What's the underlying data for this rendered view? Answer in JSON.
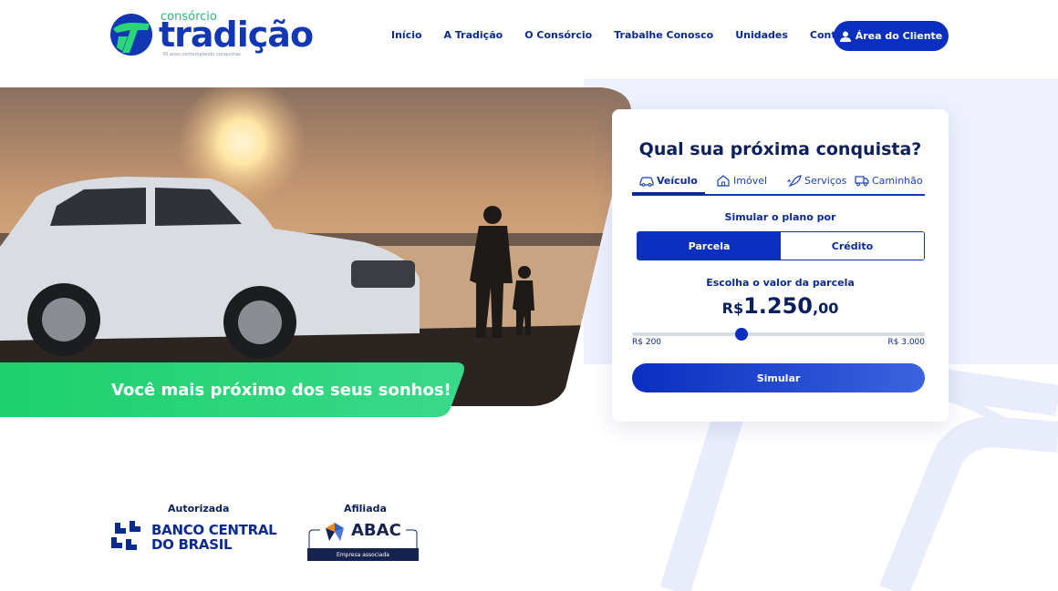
{
  "logo": {
    "small": "consórcio",
    "big": "tradição",
    "tagline": "30 anos contemplando conquistas"
  },
  "nav": {
    "items": [
      "Início",
      "A Tradição",
      "O Consórcio",
      "Trabalhe Conosco",
      "Unidades",
      "Contato"
    ],
    "client_button": "Área do Cliente"
  },
  "hero": {
    "banner": "Você mais próximo dos seus sonhos!"
  },
  "simulator": {
    "title": "Qual sua próxima conquista?",
    "tabs": [
      {
        "label": "Veículo",
        "icon": "car-icon",
        "active": true
      },
      {
        "label": "Imóvel",
        "icon": "house-icon",
        "active": false
      },
      {
        "label": "Serviços",
        "icon": "rocket-icon",
        "active": false
      },
      {
        "label": "Caminhão",
        "icon": "truck-icon",
        "active": false
      }
    ],
    "plan_label": "Simular o plano por",
    "plan_options": [
      "Parcela",
      "Crédito"
    ],
    "plan_selected": "Parcela",
    "value_label": "Escolha o valor da parcela",
    "value_currency": "R$",
    "value_integer": "1.250",
    "value_decimal": ",00",
    "slider_min": "R$ 200",
    "slider_max": "R$ 3.000",
    "slider_value": 1250,
    "slider_min_value": 200,
    "slider_max_value": 3000,
    "button": "Simular"
  },
  "badges": {
    "authorized_label": "Autorizada",
    "bcb_line1": "BANCO CENTRAL",
    "bcb_line2": "DO BRASIL",
    "affiliated_label": "Afiliada",
    "abac_name": "ABAC",
    "abac_sub": "Empresa associada"
  },
  "colors": {
    "primary": "#0a2ec0",
    "navy": "#0b1f5c",
    "green": "#2bd67b",
    "light_panel": "#eef1fd"
  }
}
